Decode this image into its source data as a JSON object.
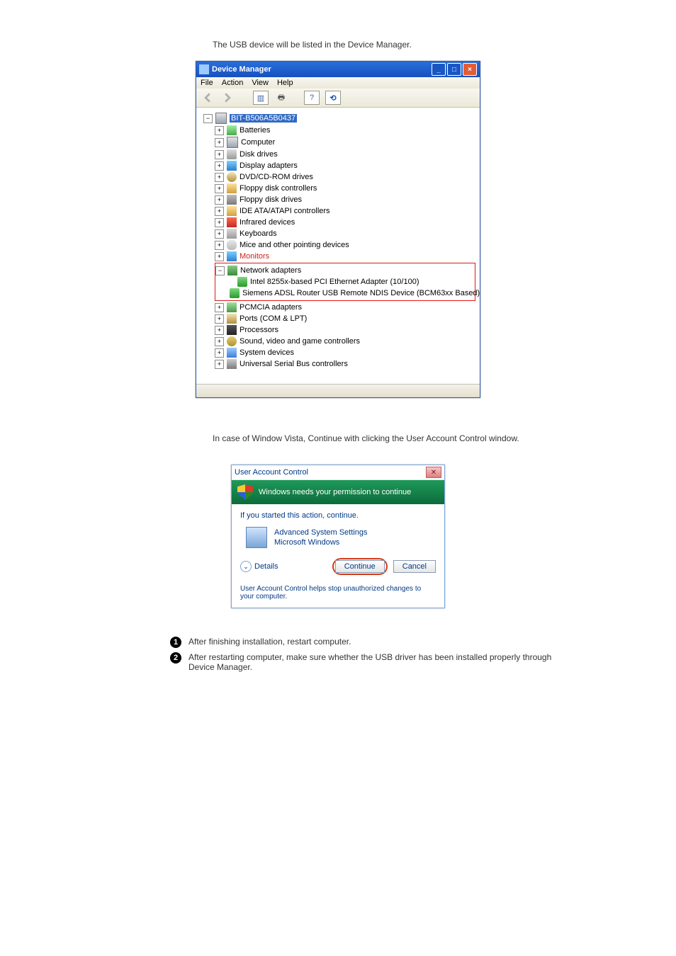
{
  "doc_intro_top": "The USB device will be listed in the Device Manager.",
  "doc_intro_vista": "In case of Window Vista, Continue with clicking the User Account Control window.",
  "device_manager": {
    "title": "Device Manager",
    "menu": {
      "file": "File",
      "action": "Action",
      "view": "View",
      "help": "Help"
    },
    "root": "BIT-B506A5B0437",
    "nodes": {
      "batteries": "Batteries",
      "computer": "Computer",
      "disk": "Disk drives",
      "display": "Display adapters",
      "dvd": "DVD/CD-ROM drives",
      "floppyctrl": "Floppy disk controllers",
      "floppy": "Floppy disk drives",
      "ide": "IDE ATA/ATAPI controllers",
      "infrared": "Infrared devices",
      "keyboard": "Keyboards",
      "mouse": "Mice and other pointing devices",
      "monitor": "Monitors",
      "network": "Network adapters",
      "network_child1": "Intel 8255x-based PCI Ethernet Adapter (10/100)",
      "network_child2": "Siemens ADSL Router USB Remote NDIS Device (BCM63xx Based)",
      "pcmcia": "PCMCIA adapters",
      "ports": "Ports (COM & LPT)",
      "cpu": "Processors",
      "sound": "Sound, video and game controllers",
      "system": "System devices",
      "usb": "Universal Serial Bus controllers"
    }
  },
  "uac": {
    "title": "User Account Control",
    "headline": "Windows needs your permission to continue",
    "line1": "If you started this action, continue.",
    "program_name": "Advanced System Settings",
    "publisher": "Microsoft Windows",
    "details_label": "Details",
    "continue_btn": "Continue",
    "cancel_btn": "Cancel",
    "footer": "User Account Control helps stop unauthorized changes to your computer."
  },
  "numbered": {
    "n1": "1",
    "n2": "2",
    "line1": "After finishing installation, restart computer.",
    "line2": "After restarting computer, make sure whether the USB driver has been installed properly through Device Manager."
  },
  "footer": {
    "left": "",
    "right": ""
  }
}
